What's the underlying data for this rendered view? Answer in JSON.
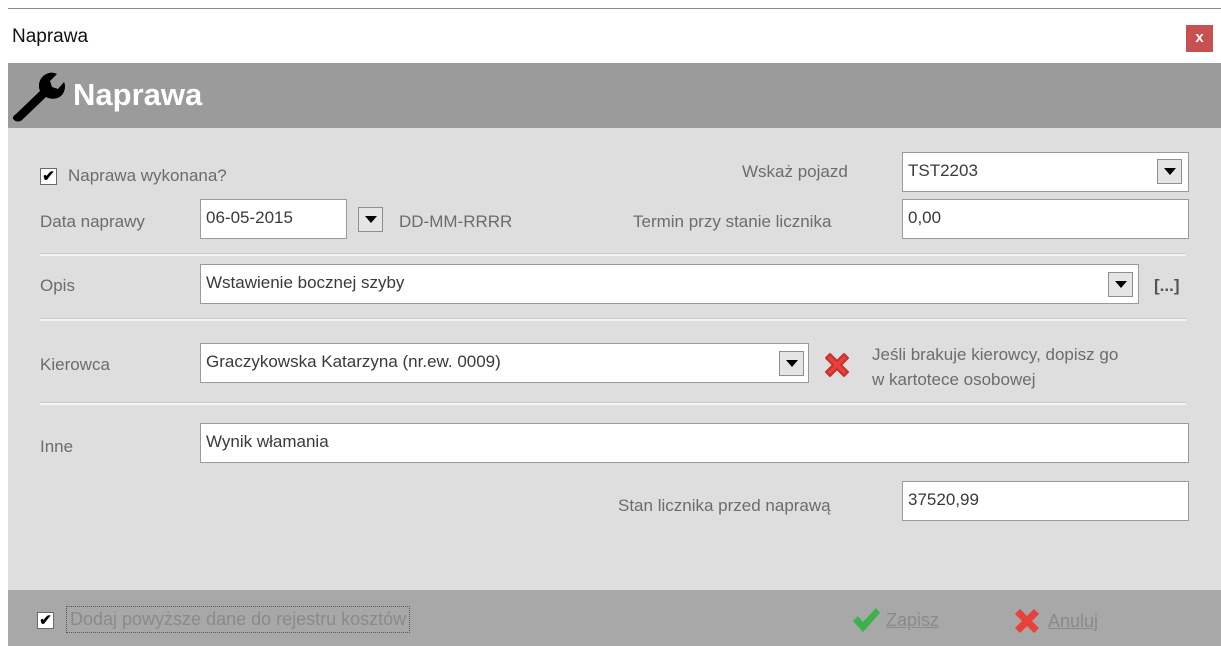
{
  "window": {
    "title": "Naprawa",
    "close_label": "x"
  },
  "header": {
    "title": "Naprawa",
    "icon": "wrench-icon"
  },
  "form": {
    "done_checkbox": {
      "label": "Naprawa wykonana?",
      "checked": true
    },
    "vehicle": {
      "label": "Wskaż pojazd",
      "value": "TST2203"
    },
    "repair_date": {
      "label": "Data naprawy",
      "value": "06-05-2015",
      "format_hint": "DD-MM-RRRR"
    },
    "odometer_due": {
      "label": "Termin przy stanie licznika",
      "value": "0,00"
    },
    "description": {
      "label": "Opis",
      "value": "Wstawienie bocznej szyby",
      "more_label": "[...]"
    },
    "driver": {
      "label": "Kierowca",
      "value": "Graczykowska Katarzyna (nr.ew. 0009)",
      "hint_line1": "Jeśli brakuje kierowcy, dopisz go",
      "hint_line2": "w kartotece osobowej"
    },
    "other": {
      "label": "Inne",
      "value": "Wynik włamania"
    },
    "odometer_before": {
      "label": "Stan licznika przed naprawą",
      "value": "37520,99"
    }
  },
  "footer": {
    "cost_checkbox": {
      "label": "Dodaj powyższe dane do rejestru kosztów",
      "checked": true
    },
    "save_label": "Zapisz",
    "cancel_label": "Anuluj"
  },
  "colors": {
    "header_bg": "#9b9b9b",
    "panel_bg": "#dedede",
    "footer_bg": "#a8a8a8",
    "close_bg": "#c75050",
    "clear_red": "#e8413c",
    "save_green": "#3bb34a"
  }
}
